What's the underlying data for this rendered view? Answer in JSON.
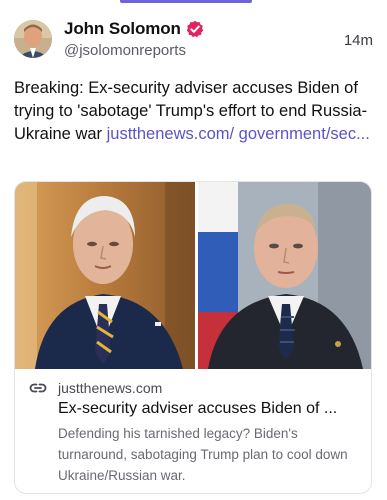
{
  "post": {
    "author_name": "John Solomon",
    "handle": "@jsolomonreports",
    "time": "14m",
    "text": "Breaking: Ex-security adviser accuses Biden of trying to 'sabotage' Trump's effort to end Russia-Ukraine war ",
    "link_text": "justthenews.com/ government/sec..."
  },
  "card": {
    "domain": "justthenews.com",
    "title": "Ex-security adviser accuses Biden of ...",
    "description": "Defending his tarnished legacy? Biden's turnaround, sabotaging Trump plan to cool down Ukraine/Russian war."
  },
  "colors": {
    "accent": "#6f63d9",
    "link": "#5b53c9",
    "verified": "#e0245e"
  },
  "icons": {
    "verified": "verified-badge-icon",
    "link": "link-icon"
  }
}
